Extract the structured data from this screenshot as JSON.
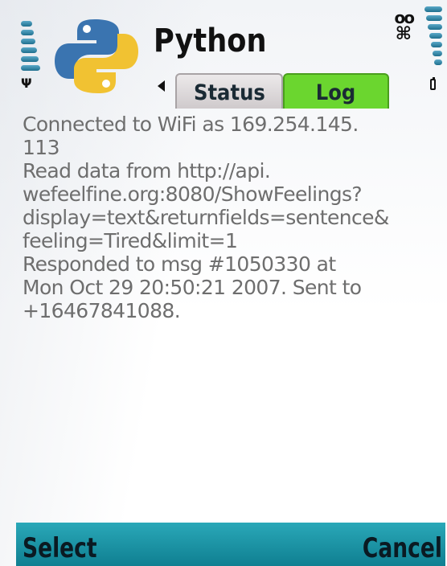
{
  "app": {
    "title": "Python"
  },
  "status_bar": {
    "signal_icon": "antenna-icon",
    "battery_icon": "battery-icon",
    "voicemail_icon": "voicemail-icon",
    "keylock_icon": "keylock-icon"
  },
  "tabs": [
    {
      "label": "Status",
      "active": false
    },
    {
      "label": "Log",
      "active": true
    }
  ],
  "log": {
    "text": "Connected to WiFi as 169.254.145.\n113\nRead data from http://api.\nwefeelfine.org:8080/ShowFeelings?\ndisplay=text&returnfields=sentence&\nfeeling=Tired&limit=1\nResponded to msg #1050330 at\nMon Oct 29 20:50:21 2007.  Sent to\n+16467841088."
  },
  "softkeys": {
    "left": "Select",
    "right": "Cancel"
  },
  "colors": {
    "active_tab": "#6bd62f",
    "softkey_bar": "#1a95a6",
    "log_text": "#6e6e6e"
  }
}
